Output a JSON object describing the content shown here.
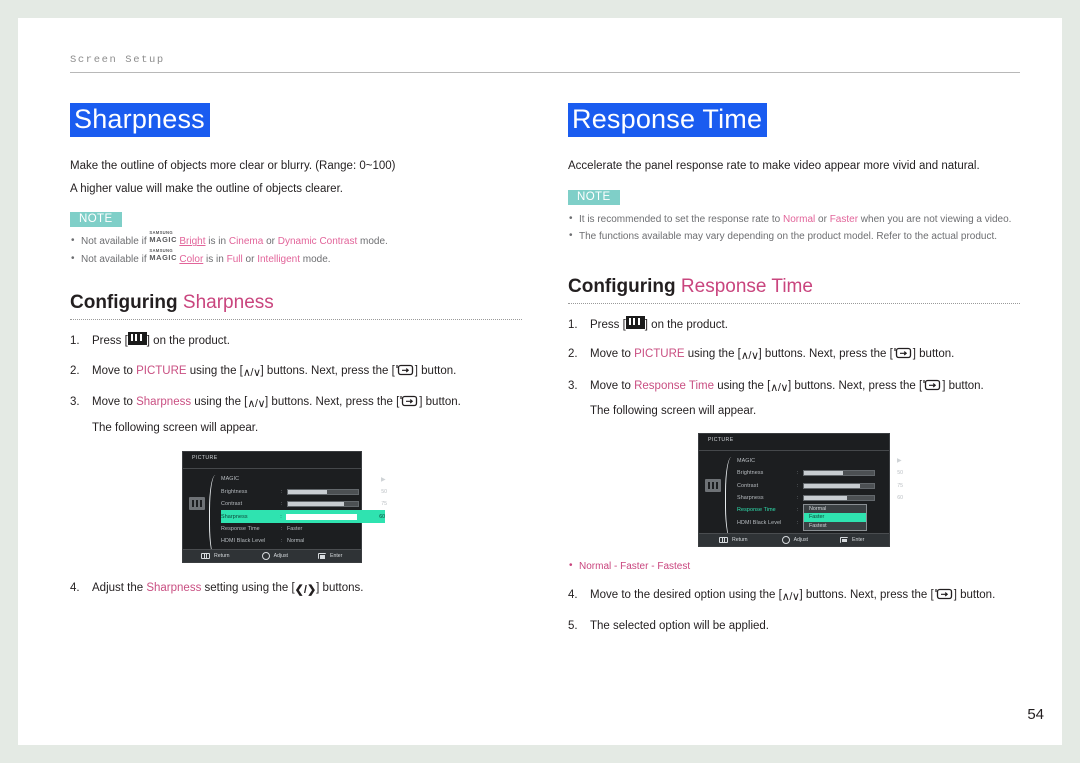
{
  "running_head": "Screen Setup",
  "page_number": "54",
  "colors": {
    "heading_highlight": "#1a5cf0",
    "note_badge": "#7fcfc8",
    "accent_pink": "#c9457e",
    "link_pink": "#e2649a",
    "osd_highlight": "#2fe3b0"
  },
  "left": {
    "title": "Sharpness",
    "intro": [
      "Make the outline of objects more clear or blurry. (Range: 0~100)",
      "A higher value will make the outline of objects clearer."
    ],
    "note_label": "NOTE",
    "notes": [
      {
        "pre": "Not available if ",
        "magic_top": "SAMSUNG",
        "magic_bottom": "MAGIC",
        "magic_word": "Bright",
        "mid": " is in ",
        "term1": "Cinema",
        "joiner": " or ",
        "term2": "Dynamic Contrast",
        "post": " mode."
      },
      {
        "pre": "Not available if ",
        "magic_top": "SAMSUNG",
        "magic_bottom": "MAGIC",
        "magic_word": "Color",
        "mid": " is in ",
        "term1": "Full",
        "joiner": " or ",
        "term2": "Intelligent",
        "post": " mode."
      }
    ],
    "configuring_prefix": "Configuring",
    "configuring_target": "Sharpness",
    "steps": [
      {
        "parts": [
          "Press [",
          "MENU_ICON",
          "] on the product."
        ]
      },
      {
        "parts": [
          "Move to ",
          "PICTURE",
          " using the [",
          "UD_ICON",
          "] buttons. Next, press the [",
          "ENTER_ICON",
          "] button."
        ]
      },
      {
        "parts": [
          "Move to ",
          "Sharpness",
          " using the [",
          "UD_ICON",
          "] buttons. Next, press the [",
          "ENTER_ICON",
          "] button."
        ],
        "sub": "The following screen will appear."
      },
      {
        "parts": [
          "Adjust the ",
          "Sharpness",
          " setting using the [",
          "LR_ICON",
          "] buttons."
        ]
      }
    ],
    "step2_accent": "PICTURE",
    "step3_accent": "Sharpness",
    "step4_accent": "Sharpness",
    "osd": {
      "title": "PICTURE",
      "rows": [
        {
          "label": "MAGIC",
          "type": "arrow"
        },
        {
          "label": "Brightness",
          "type": "slider",
          "value": "50",
          "fill": 55
        },
        {
          "label": "Contrast",
          "type": "slider",
          "value": "75",
          "fill": 80
        },
        {
          "label": "Sharpness",
          "type": "slider",
          "value": "60",
          "fill": 62,
          "selected": true
        },
        {
          "label": "Response Time",
          "type": "text",
          "value": "Faster"
        },
        {
          "label": "HDMI Black Level",
          "type": "text",
          "value": "Normal"
        }
      ],
      "footer": [
        {
          "icon": "menu-icon",
          "label": "Return"
        },
        {
          "icon": "adjust-icon",
          "label": "Adjust"
        },
        {
          "icon": "enter-icon",
          "label": "Enter"
        }
      ]
    }
  },
  "right": {
    "title": "Response Time",
    "intro": [
      "Accelerate the panel response rate to make video appear more vivid and natural."
    ],
    "note_label": "NOTE",
    "notes": [
      {
        "pre": "It is recommended to set the response rate to ",
        "term1": "Normal",
        "joiner": " or ",
        "term2": "Faster",
        "post": " when you are not viewing a video."
      },
      {
        "plain": "The functions available may vary depending on the product model. Refer to the actual product."
      }
    ],
    "configuring_prefix": "Configuring",
    "configuring_target": "Response Time",
    "step2_accent": "PICTURE",
    "step3_accent": "Response Time",
    "steps": [
      {
        "parts": [
          "Press [",
          "MENU_ICON",
          "] on the product."
        ]
      },
      {
        "parts": [
          "Move to ",
          "PICTURE",
          " using the [",
          "UD_ICON",
          "] buttons. Next, press the [",
          "ENTER_ICON",
          "] button."
        ]
      },
      {
        "parts": [
          "Move to ",
          "Response Time",
          " using the [",
          "UD_ICON",
          "] buttons. Next, press the [",
          "ENTER_ICON",
          "] button."
        ],
        "sub": "The following screen will appear."
      },
      {
        "parts": [
          "Move to the desired option using the [",
          "UD_ICON",
          "] buttons. Next, press the [",
          "ENTER_ICON",
          "] button."
        ]
      },
      {
        "parts": [
          "The selected option will be applied."
        ]
      }
    ],
    "options_line": "Normal - Faster - Fastest",
    "osd": {
      "title": "PICTURE",
      "rows": [
        {
          "label": "MAGIC",
          "type": "arrow"
        },
        {
          "label": "Brightness",
          "type": "slider",
          "value": "50",
          "fill": 55
        },
        {
          "label": "Contrast",
          "type": "slider",
          "value": "75",
          "fill": 80
        },
        {
          "label": "Sharpness",
          "type": "slider",
          "value": "60",
          "fill": 62
        },
        {
          "label": "Response Time",
          "type": "text",
          "value": "",
          "highlight": true
        },
        {
          "label": "HDMI Black Level",
          "type": "text",
          "value": ""
        }
      ],
      "dropdown": [
        {
          "label": "Normal",
          "selected": false
        },
        {
          "label": "Faster",
          "selected": true
        },
        {
          "label": "Fastest",
          "selected": false
        }
      ],
      "footer": [
        {
          "icon": "menu-icon",
          "label": "Return"
        },
        {
          "icon": "adjust-icon",
          "label": "Adjust"
        },
        {
          "icon": "enter-icon",
          "label": "Enter"
        }
      ]
    }
  }
}
